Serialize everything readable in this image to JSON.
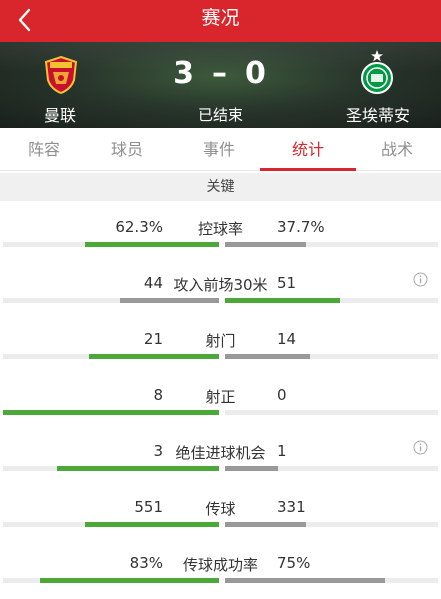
{
  "nav": {
    "title": "赛况"
  },
  "match": {
    "home_team": "曼联",
    "away_team": "圣埃蒂安",
    "home_score": "3",
    "away_score": "0",
    "score_separator": "–",
    "status": "已结束"
  },
  "tabs": [
    {
      "label": "阵容",
      "active": false
    },
    {
      "label": "球员",
      "active": false
    },
    {
      "label": "事件",
      "active": false
    },
    {
      "label": "统计",
      "active": true
    },
    {
      "label": "战术",
      "active": false
    }
  ],
  "section": {
    "title": "关键"
  },
  "stats": [
    {
      "name": "控球率",
      "home": "62.3%",
      "away": "37.7%",
      "home_value": 62.3,
      "away_value": 37.7,
      "home_fill": 0.62,
      "away_fill": 0.38,
      "info": false
    },
    {
      "name": "攻入前场30米",
      "home": "44",
      "away": "51",
      "home_value": 44,
      "away_value": 51,
      "home_fill": 0.46,
      "away_fill": 0.54,
      "info": true
    },
    {
      "name": "射门",
      "home": "21",
      "away": "14",
      "home_value": 21,
      "away_value": 14,
      "home_fill": 0.6,
      "away_fill": 0.4,
      "info": false
    },
    {
      "name": "射正",
      "home": "8",
      "away": "0",
      "home_value": 8,
      "away_value": 0,
      "home_fill": 1.0,
      "away_fill": 0.0,
      "info": false
    },
    {
      "name": "绝佳进球机会",
      "home": "3",
      "away": "1",
      "home_value": 3,
      "away_value": 1,
      "home_fill": 0.75,
      "away_fill": 0.25,
      "info": true
    },
    {
      "name": "传球",
      "home": "551",
      "away": "331",
      "home_value": 551,
      "away_value": 331,
      "home_fill": 0.62,
      "away_fill": 0.38,
      "info": false
    },
    {
      "name": "传球成功率",
      "home": "83%",
      "away": "75%",
      "home_value": 83,
      "away_value": 75,
      "home_fill": 0.83,
      "away_fill": 0.75,
      "info": false
    }
  ],
  "colors": {
    "brand_red": "#d9262c",
    "win_bar": "#4da83a",
    "lose_bar": "#999999"
  },
  "icons": {
    "back": "chevron-left-icon",
    "info": "info-circle-icon",
    "home_logo": "manchester-united-crest",
    "away_logo": "saint-etienne-crest"
  }
}
